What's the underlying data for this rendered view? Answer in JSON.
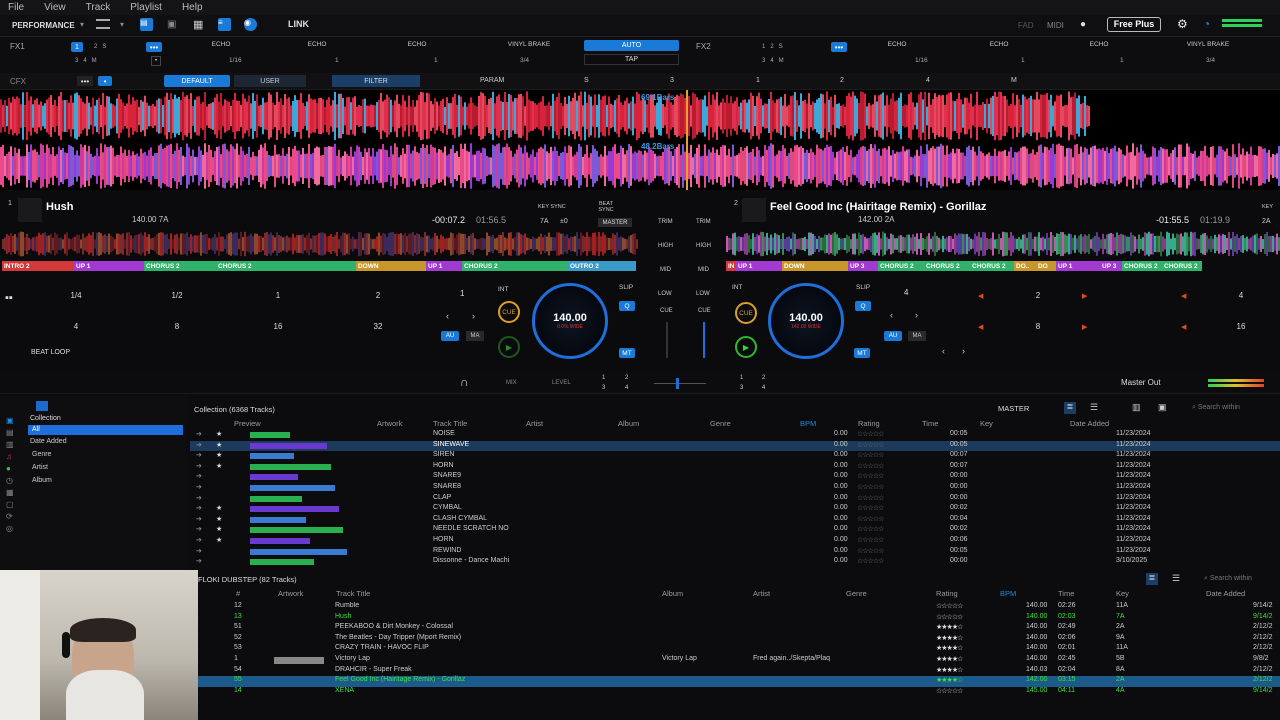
{
  "menu": [
    "File",
    "View",
    "Track",
    "Playlist",
    "Help"
  ],
  "toolbar": {
    "mode": "PERFORMANCE",
    "link": "LINK",
    "fad": "FAD",
    "midi": "MIDI",
    "free_plus": "Free Plus"
  },
  "fx1": {
    "label": "FX1",
    "tempo": "1/16",
    "beat": "3/4",
    "e1": "ECHO",
    "e2": "ECHO",
    "e3": "ECHO",
    "vinyl": "VINYL BRAKE",
    "auto": "AUTO",
    "tap": "TAP",
    "n1": "1",
    "n2": "1",
    "n3": "1"
  },
  "fx2": {
    "label": "FX2",
    "tempo": "1/16",
    "beat": "3/4",
    "e1": "ECHO",
    "e2": "ECHO",
    "e3": "ECHO",
    "vinyl": "VINYL BRAKE",
    "n1": "1",
    "n2": "1",
    "n3": "1"
  },
  "cfx": {
    "label": "CFX",
    "default": "DEFAULT",
    "user": "USER",
    "filter": "FILTER",
    "param": "PARAM",
    "s": "S",
    "m": "M",
    "n3": "3",
    "n1": "1",
    "n2": "2",
    "n4": "4"
  },
  "wave": {
    "bars1": "69.1Bars",
    "bars2": "48.2Bars"
  },
  "deck1": {
    "num": "1",
    "title": "Hush",
    "bpm_key": "140.00 7A",
    "elapsed": "-00:07.2",
    "remain": "01:56.5",
    "keysync": "KEY SYNC",
    "beatsync": "BEAT SYNC",
    "key": "7A",
    "pm": "±0",
    "master": "MASTER",
    "cues": [
      {
        "t": "INTRO 2",
        "c": "#d23a3a",
        "w": 72
      },
      {
        "t": "UP 1",
        "c": "#a23ad2",
        "w": 70
      },
      {
        "t": "CHORUS 2",
        "c": "#2fb36a",
        "w": 72
      },
      {
        "t": "CHORUS 2",
        "c": "#2fb36a",
        "w": 140
      },
      {
        "t": "DOWN",
        "c": "#c8962a",
        "w": 70
      },
      {
        "t": "UP 1",
        "c": "#a23ad2",
        "w": 36
      },
      {
        "t": "CHORUS 2",
        "c": "#2fb36a",
        "w": 106
      },
      {
        "t": "OUTRO 2",
        "c": "#3a9ac8",
        "w": 68
      }
    ],
    "pads": [
      "1/4",
      "1/2",
      "1",
      "2",
      "4",
      "8",
      "16",
      "32"
    ],
    "beatloop": "BEAT LOOP",
    "loop": "1",
    "int": "INT",
    "slip": "SLIP",
    "q": "Q",
    "cue": "CUE",
    "au": "AU",
    "ma": "MA",
    "mt": "MT",
    "jog_bpm": "140.00",
    "jog_pct": "0.0% WIDE"
  },
  "deck2": {
    "num": "2",
    "title": "Feel Good Inc (Hairitage Remix) - Gorillaz",
    "bpm_key": "142.00 2A",
    "remain": "-01:55.5",
    "total": "01:19.9",
    "key": "2A",
    "keysync": "KEY",
    "cues": [
      {
        "t": "IN",
        "c": "#d23a3a",
        "w": 10
      },
      {
        "t": "UP 1",
        "c": "#a23ad2",
        "w": 46
      },
      {
        "t": "DOWN",
        "c": "#c8962a",
        "w": 66
      },
      {
        "t": "UP 3",
        "c": "#a23ad2",
        "w": 30
      },
      {
        "t": "CHORUS 2",
        "c": "#2fb36a",
        "w": 46
      },
      {
        "t": "CHORUS 2",
        "c": "#2fb36a",
        "w": 46
      },
      {
        "t": "CHORUS 2",
        "c": "#2fb36a",
        "w": 44
      },
      {
        "t": "DO..",
        "c": "#c8962a",
        "w": 22
      },
      {
        "t": "DO",
        "c": "#c8962a",
        "w": 20
      },
      {
        "t": "UP 1",
        "c": "#a23ad2",
        "w": 44
      },
      {
        "t": "UP 3",
        "c": "#a23ad2",
        "w": 22
      },
      {
        "t": "CHORUS 2",
        "c": "#2fb36a",
        "w": 40
      },
      {
        "t": "CHORUS 2",
        "c": "#2fb36a",
        "w": 40
      }
    ],
    "loop": "4",
    "pads": [
      "2",
      "4",
      "8",
      "16"
    ],
    "jog_bpm": "140.00",
    "jog_pct": "142.00 WIDE",
    "int": "INT",
    "slip": "SLIP",
    "cue": "CUE",
    "au": "AU",
    "ma": "MA",
    "mt": "MT",
    "q": "Q"
  },
  "mixer": {
    "trim": "TRIM",
    "high": "HIGH",
    "mid": "MID",
    "low": "LOW",
    "cue": "CUE"
  },
  "browserbar": {
    "mix": "MIX",
    "level": "LEVEL",
    "b1": "1",
    "b2": "2",
    "b3": "3",
    "b4": "4",
    "b5": "1",
    "b6": "2",
    "b7": "3",
    "b8": "4",
    "master_out": "Master Out",
    "master": "MASTER"
  },
  "tree": [
    "Collection",
    "All",
    "Date Added",
    "Genre",
    "Artist",
    "Album"
  ],
  "collection": {
    "title": "Collection (6368 Tracks)",
    "search": "Search within",
    "headers": {
      "preview": "Preview",
      "artwork": "Artwork",
      "title": "Track Title",
      "artist": "Artist",
      "album": "Album",
      "genre": "Genre",
      "bpm": "BPM",
      "rating": "Rating",
      "time": "Time",
      "key": "Key",
      "date": "Date Added"
    },
    "rows": [
      {
        "t": "NOISE",
        "b": "0.00",
        "tm": "00:05",
        "d": "11/23/2024"
      },
      {
        "t": "SINEWAVE",
        "b": "0.00",
        "tm": "00:05",
        "d": "11/23/2024"
      },
      {
        "t": "SIREN",
        "b": "0.00",
        "tm": "00:07",
        "d": "11/23/2024"
      },
      {
        "t": "HORN",
        "b": "0.00",
        "tm": "00:07",
        "d": "11/23/2024"
      },
      {
        "t": "SNARE9",
        "b": "0.00",
        "tm": "00:00",
        "d": "11/23/2024"
      },
      {
        "t": "SNARE8",
        "b": "0.00",
        "tm": "00:00",
        "d": "11/23/2024"
      },
      {
        "t": "CLAP",
        "b": "0.00",
        "tm": "00:00",
        "d": "11/23/2024"
      },
      {
        "t": "CYMBAL",
        "b": "0.00",
        "tm": "00:02",
        "d": "11/23/2024"
      },
      {
        "t": "CLASH CYMBAL",
        "b": "0.00",
        "tm": "00:04",
        "d": "11/23/2024"
      },
      {
        "t": "NEEDLE SCRATCH NO",
        "b": "0.00",
        "tm": "00:02",
        "d": "11/23/2024"
      },
      {
        "t": "HORN",
        "b": "0.00",
        "tm": "00:06",
        "d": "11/23/2024"
      },
      {
        "t": "REWIND",
        "b": "0.00",
        "tm": "00:05",
        "d": "11/23/2024"
      },
      {
        "t": "Dissonne - Dance Machi",
        "b": "0.00",
        "tm": "00:00",
        "d": "3/10/2025"
      }
    ]
  },
  "playlist": {
    "title": "FLOKI DUBSTEP (82 Tracks)",
    "search": "Search within",
    "headers": {
      "num": "#",
      "artwork": "Artwork",
      "title": "Track Title",
      "album": "Album",
      "artist": "Artist",
      "genre": "Genre",
      "rating": "Rating",
      "bpm": "BPM",
      "time": "Time",
      "key": "Key",
      "date": "Date Added"
    },
    "rows": [
      {
        "n": "12",
        "t": "Rumble",
        "al": "",
        "ar": "",
        "b": "140.00",
        "tm": "02:26",
        "k": "11A",
        "d": "9/14/2",
        "c": "#ccc"
      },
      {
        "n": "13",
        "t": "Hush",
        "al": "",
        "ar": "",
        "b": "140.00",
        "tm": "02:03",
        "k": "7A",
        "d": "9/14/2",
        "c": "#3de03d"
      },
      {
        "n": "51",
        "t": "PEEKABOO & Dirt Monkey - Colossal",
        "al": "",
        "ar": "",
        "b": "140.00",
        "tm": "02:49",
        "k": "2A",
        "d": "2/12/2",
        "c": "#ccc"
      },
      {
        "n": "52",
        "t": "The Beatles - Day Tripper (Mport Remix)",
        "al": "",
        "ar": "",
        "b": "140.00",
        "tm": "02:06",
        "k": "9A",
        "d": "2/12/2",
        "c": "#ccc"
      },
      {
        "n": "53",
        "t": "CRAZY TRAIN - HAVOC FLIP",
        "al": "",
        "ar": "",
        "b": "140.00",
        "tm": "02:01",
        "k": "11A",
        "d": "2/12/2",
        "c": "#ccc"
      },
      {
        "n": "1",
        "t": "Victory Lap",
        "al": "Victory Lap",
        "ar": "Fred again../Skepta/Plaq",
        "b": "140.00",
        "tm": "02:45",
        "k": "5B",
        "d": "9/8/2",
        "c": "#ccc"
      },
      {
        "n": "54",
        "t": "DRAHCIR - Super Freak",
        "al": "",
        "ar": "",
        "b": "140.03",
        "tm": "02:04",
        "k": "8A",
        "d": "2/12/2",
        "c": "#ccc"
      },
      {
        "n": "55",
        "t": "Feel Good Inc (Hairitage Remix) - Gorillaz",
        "al": "",
        "ar": "",
        "b": "142.00",
        "tm": "03:15",
        "k": "2A",
        "d": "2/12/2",
        "c": "#3de03d"
      },
      {
        "n": "14",
        "t": "XENA",
        "al": "",
        "ar": "",
        "b": "145.00",
        "tm": "04:11",
        "k": "4A",
        "d": "9/14/2",
        "c": "#3de03d"
      }
    ]
  }
}
